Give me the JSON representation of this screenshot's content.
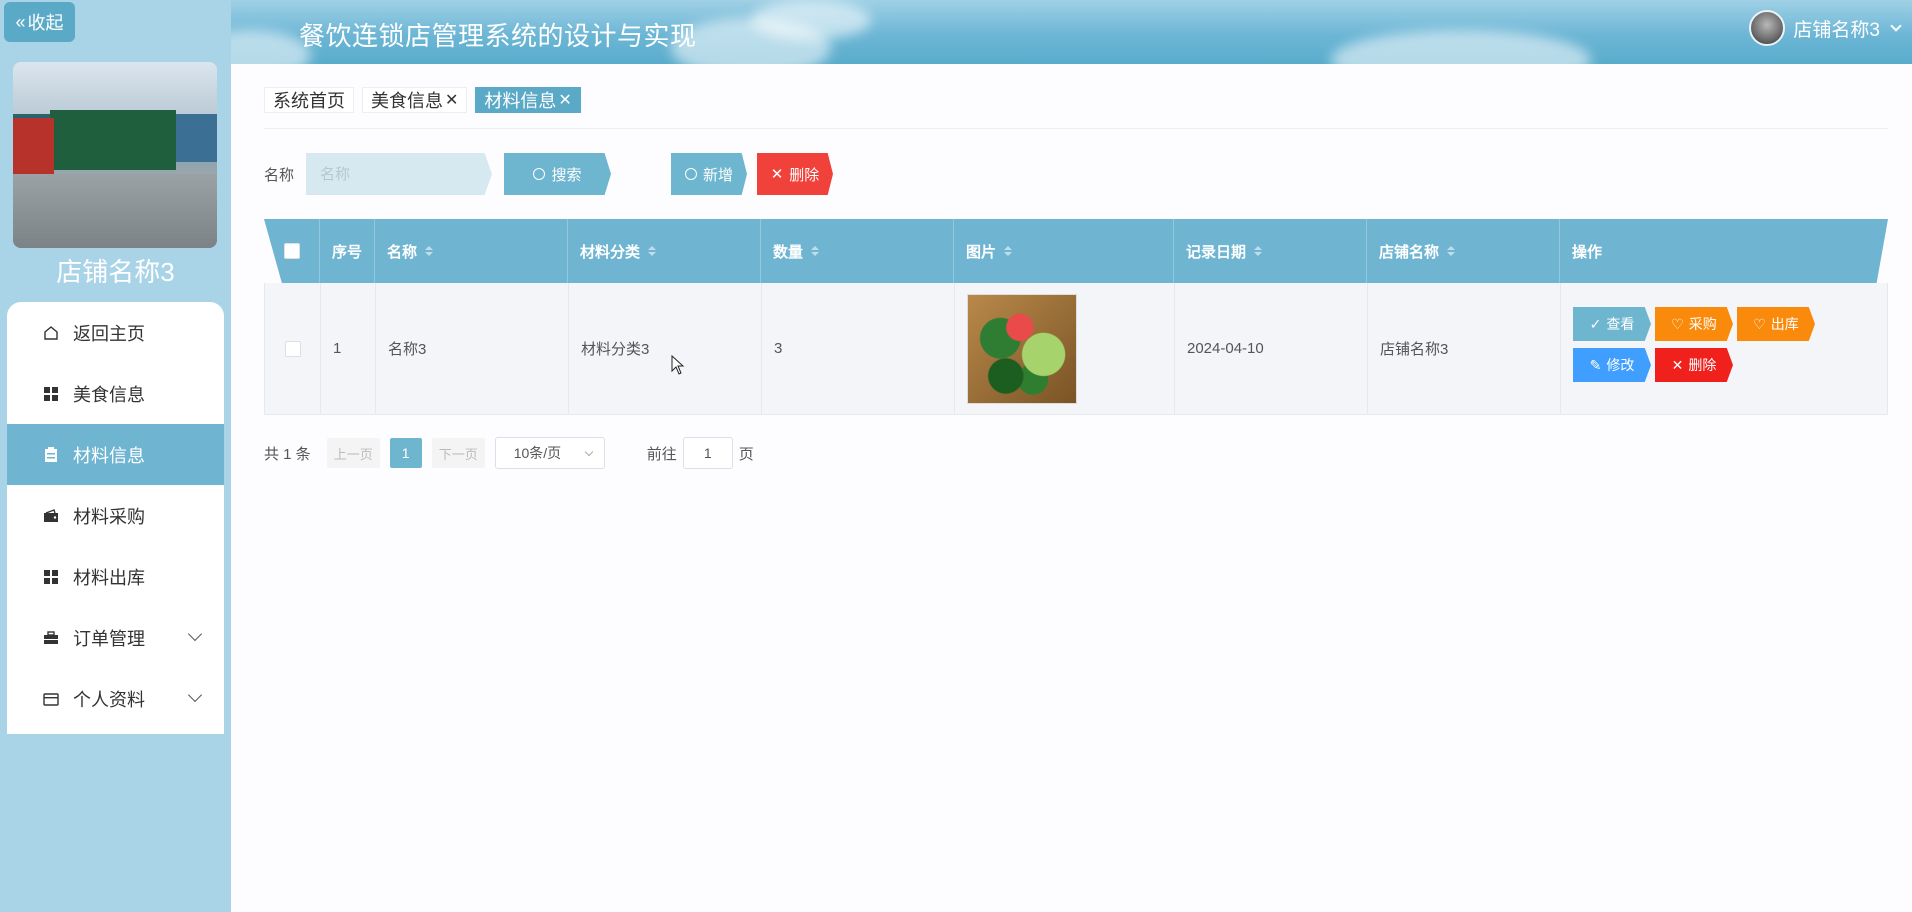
{
  "sidebar": {
    "collapse_label": "收起",
    "shop_name": "店铺名称3",
    "items": [
      {
        "label": "返回主页",
        "icon": "home-icon"
      },
      {
        "label": "美食信息",
        "icon": "grid-icon"
      },
      {
        "label": "材料信息",
        "icon": "clipboard-icon",
        "active": true
      },
      {
        "label": "材料采购",
        "icon": "wallet-icon"
      },
      {
        "label": "材料出库",
        "icon": "grid-icon"
      },
      {
        "label": "订单管理",
        "icon": "briefcase-icon",
        "expandable": true
      },
      {
        "label": "个人资料",
        "icon": "card-icon",
        "expandable": true
      }
    ]
  },
  "header": {
    "title": "餐饮连锁店管理系统的设计与实现",
    "user_name": "店铺名称3"
  },
  "tabs": [
    {
      "label": "系统首页",
      "closable": false
    },
    {
      "label": "美食信息",
      "closable": true
    },
    {
      "label": "材料信息",
      "closable": true,
      "active": true
    }
  ],
  "search": {
    "label": "名称",
    "placeholder": "名称",
    "search_button": "搜索",
    "add_button": "新增",
    "delete_button": "删除"
  },
  "table": {
    "columns": [
      "序号",
      "名称",
      "材料分类",
      "数量",
      "图片",
      "记录日期",
      "店铺名称",
      "操作"
    ],
    "rows": [
      {
        "index": "1",
        "name": "名称3",
        "category": "材料分类3",
        "quantity": "3",
        "image": "vegetables-image",
        "date": "2024-04-10",
        "shop": "店铺名称3",
        "actions": {
          "view": "查看",
          "purchase": "采购",
          "outbound": "出库",
          "edit": "修改",
          "delete": "删除"
        }
      }
    ]
  },
  "pagination": {
    "total_text": "共 1 条",
    "prev": "上一页",
    "page": "1",
    "next": "下一页",
    "page_size": "10条/页",
    "goto_prefix": "前往",
    "goto_value": "1",
    "goto_suffix": "页"
  },
  "colors": {
    "primary": "#6eb6d0",
    "danger": "#f0423a",
    "warning": "#f98a0c",
    "edit": "#409eff",
    "sidebar_bg": "#a9d3e6"
  }
}
